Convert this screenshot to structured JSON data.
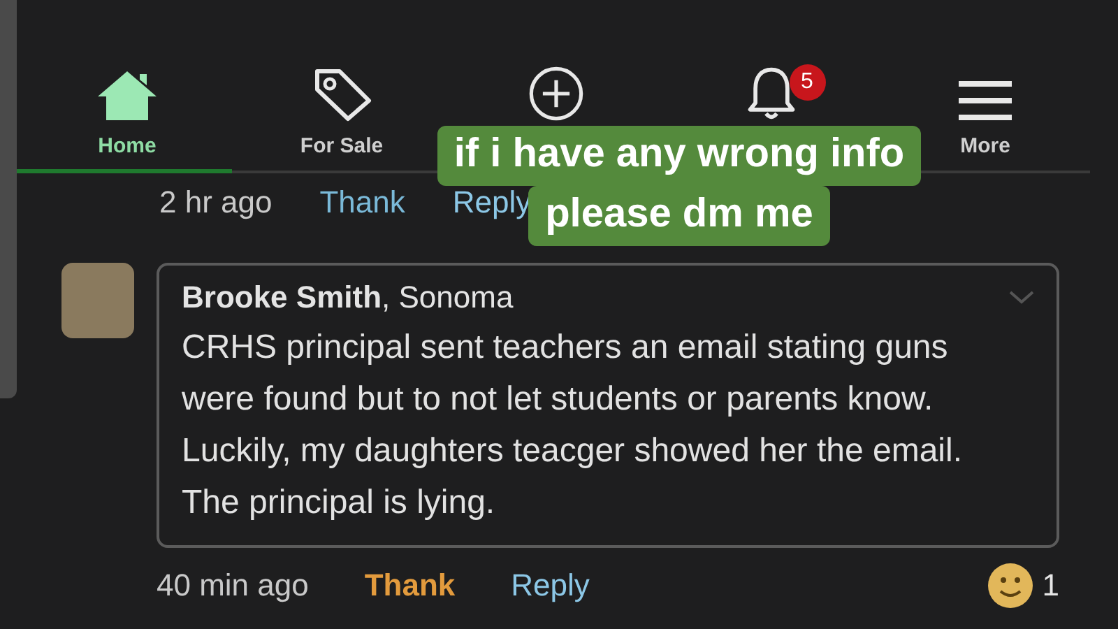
{
  "tabs": [
    {
      "kind": "home",
      "label": "Home",
      "selected": true
    },
    {
      "kind": "tag",
      "label": "For Sale",
      "selected": false
    },
    {
      "kind": "plus",
      "selected": false
    },
    {
      "kind": "bell",
      "badge": "5",
      "selected": false
    },
    {
      "kind": "menu",
      "label": "More",
      "selected": false
    }
  ],
  "previous_comment": {
    "time": "2 hr ago",
    "thank": {
      "label": "Thank",
      "thanked": false
    },
    "reply": "Reply"
  },
  "comment": {
    "author": "**Brooke Smith**, Sonoma",
    "body": "CRHS principal sent teachers an email stating guns were found but to not let students or parents know. Luckily, my daughters teacger showed her the email. The principal is lying.",
    "time": "40 min ago",
    "thank": {
      "label": "Thank",
      "thanked": true
    },
    "reply": "Reply",
    "reactions": "1"
  },
  "caption": [
    "if i have any wrong info",
    "please dm me"
  ]
}
